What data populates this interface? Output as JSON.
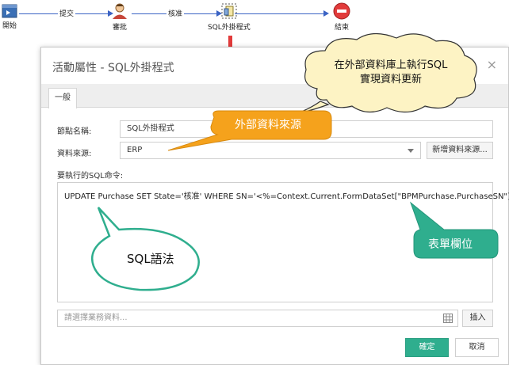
{
  "workflow": {
    "nodes": [
      {
        "label": "開始"
      },
      {
        "label": "審批"
      },
      {
        "label": "SQL外掛程式"
      },
      {
        "label": "結束"
      }
    ],
    "edges": [
      {
        "label": "提交"
      },
      {
        "label": "核准"
      }
    ]
  },
  "dialog": {
    "title": "活動屬性 - SQL外掛程式",
    "close": "×",
    "tab": "一般",
    "node_name_label": "節點名稱:",
    "node_name_value": "SQL外掛程式",
    "source_label": "資料來源:",
    "source_value": "ERP",
    "new_source_button": "新增資料來源...",
    "sql_label": "要執行的SQL命令:",
    "sql_text": "UPDATE Purchase SET State='核准' WHERE SN='<%=Context.Current.FormDataSet[\"BPMPurchase.PurchaseSN\"]%>'",
    "business_placeholder": "請選擇業務資料...",
    "insert_button": "插入",
    "ok_button": "確定",
    "cancel_button": "取消"
  },
  "callouts": {
    "db_update_line1": "在外部資料庫上執行SQL",
    "db_update_line2": "實現資料更新",
    "external_source": "外部資料來源",
    "sql_syntax": "SQL語法",
    "form_field": "表單欄位"
  },
  "colors": {
    "orange": "#f5a21c",
    "teal": "#2fae8e",
    "cloud": "#fdf3c4",
    "red": "#e23b3b",
    "flow": "#3b63c4"
  }
}
